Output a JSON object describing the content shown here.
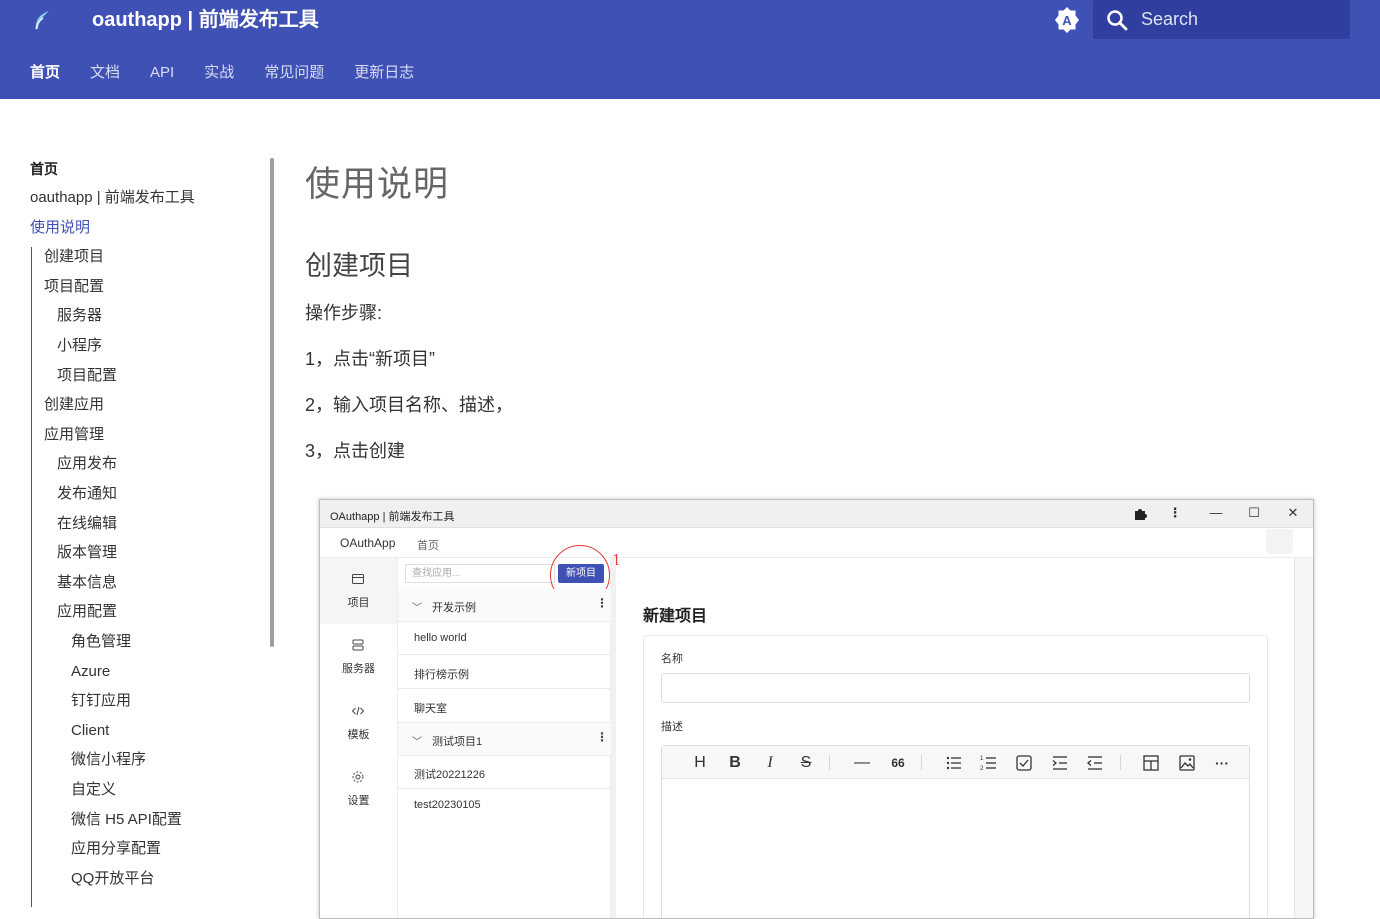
{
  "header": {
    "site_title": "oauthapp | 前端发布工具",
    "search_placeholder": "Search",
    "tabs": [
      "首页",
      "文档",
      "API",
      "实战",
      "常见问题",
      "更新日志"
    ],
    "lang_icon_letter": "A",
    "accent_color": "#3f51b5"
  },
  "sidebar": {
    "heading": "首页",
    "items": [
      {
        "label": "oauthapp | 前端发布工具",
        "level": 0
      },
      {
        "label": "使用说明",
        "level": 0
      },
      {
        "label": "创建项目",
        "level": 1
      },
      {
        "label": "项目配置",
        "level": 1
      },
      {
        "label": "服务器",
        "level": 2
      },
      {
        "label": "小程序",
        "level": 2
      },
      {
        "label": "项目配置",
        "level": 2
      },
      {
        "label": "创建应用",
        "level": 1
      },
      {
        "label": "应用管理",
        "level": 1
      },
      {
        "label": "应用发布",
        "level": 2
      },
      {
        "label": "发布通知",
        "level": 2
      },
      {
        "label": "在线编辑",
        "level": 2
      },
      {
        "label": "版本管理",
        "level": 2
      },
      {
        "label": "基本信息",
        "level": 2
      },
      {
        "label": "应用配置",
        "level": 2
      },
      {
        "label": "角色管理",
        "level": 3
      },
      {
        "label": "Azure",
        "level": 3
      },
      {
        "label": "钉钉应用",
        "level": 3
      },
      {
        "label": "Client",
        "level": 3
      },
      {
        "label": "微信小程序",
        "level": 3
      },
      {
        "label": "自定义",
        "level": 3
      },
      {
        "label": "微信 H5 API配置",
        "level": 3
      },
      {
        "label": "应用分享配置",
        "level": 3
      },
      {
        "label": "QQ开放平台",
        "level": 3
      }
    ]
  },
  "main": {
    "page_title": "使用说明",
    "section_title": "创建项目",
    "steps_label": "操作步骤:",
    "steps": [
      "1，点击“新项目”",
      "2，输入项目名称、描述，",
      "3，点击创建"
    ]
  },
  "screenshot": {
    "window_title": "OAuthapp | 前端发布工具",
    "brand": "OAuthApp",
    "nav_home": "首页",
    "rail": [
      {
        "label": "项目",
        "icon": "folder-icon"
      },
      {
        "label": "服务器",
        "icon": "server-icon"
      },
      {
        "label": "模板",
        "icon": "code-icon"
      },
      {
        "label": "设置",
        "icon": "gear-icon"
      }
    ],
    "find_placeholder": "查找应用...",
    "new_button": "新项目",
    "annotation_number": "1",
    "groups": [
      {
        "name": "开发示例",
        "items": [
          "hello world",
          "排行榜示例",
          "聊天室"
        ]
      },
      {
        "name": "测试项目1",
        "items": [
          "测试20221226",
          "test20230105"
        ]
      }
    ],
    "form": {
      "title": "新建项目",
      "name_label": "名称",
      "desc_label": "描述"
    },
    "toolbar": {
      "heading": "H",
      "bold": "B",
      "italic": "I",
      "strike": "S",
      "quote": "66"
    }
  }
}
